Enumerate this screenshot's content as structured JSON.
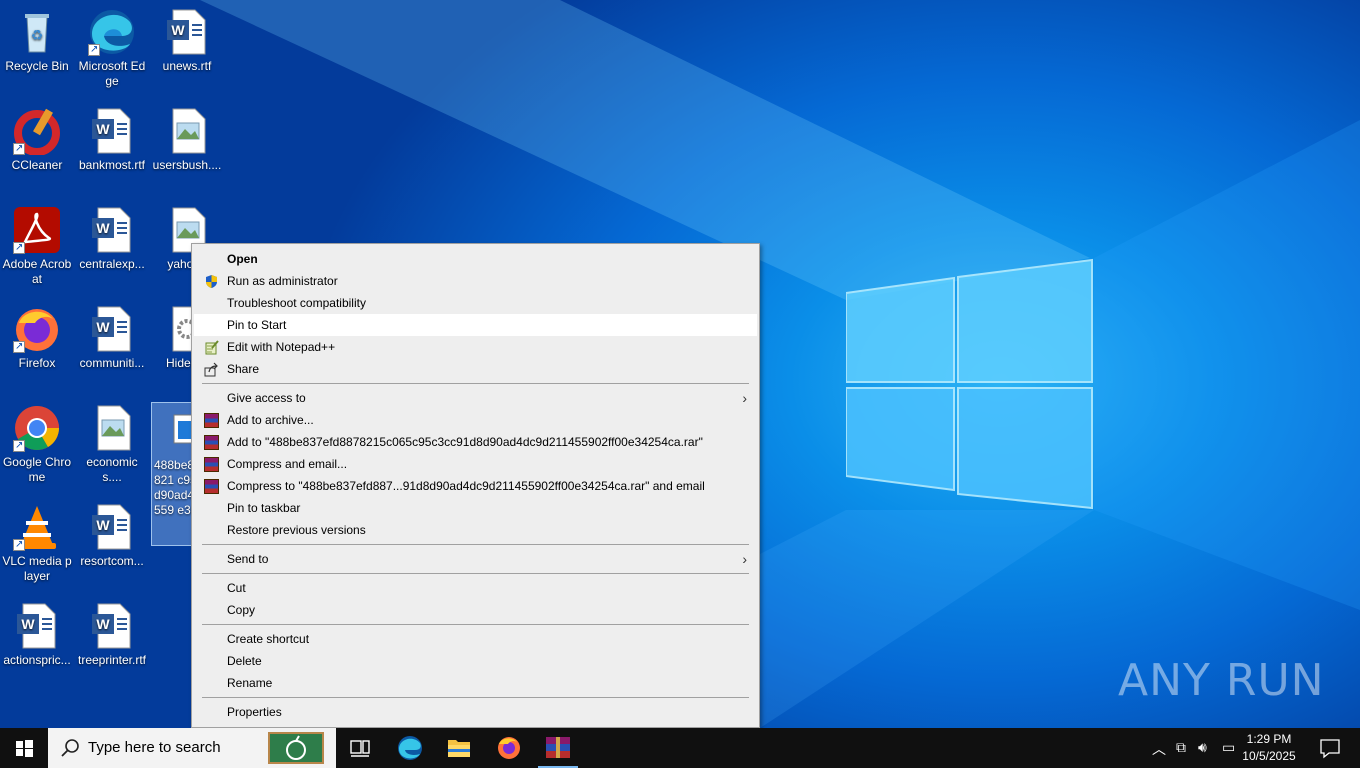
{
  "desktop_icons": [
    {
      "label": "Recycle Bin",
      "icon": "recycle-bin-icon"
    },
    {
      "label": "Microsoft Edge",
      "icon": "edge-icon"
    },
    {
      "label": "unews.rtf",
      "icon": "word-doc-icon"
    },
    {
      "label": "CCleaner",
      "icon": "ccleaner-icon"
    },
    {
      "label": "bankmost.rtf",
      "icon": "word-doc-icon"
    },
    {
      "label": "usersbush....",
      "icon": "image-file-icon"
    },
    {
      "label": "Adobe Acrobat",
      "icon": "acrobat-icon"
    },
    {
      "label": "centralexp...",
      "icon": "word-doc-icon"
    },
    {
      "label": "yahoog",
      "icon": "image-file-icon"
    },
    {
      "label": "Firefox",
      "icon": "firefox-icon"
    },
    {
      "label": "communiti...",
      "icon": "word-doc-icon"
    },
    {
      "label": "HidePlu",
      "icon": "settings-file-icon"
    },
    {
      "label": "Google Chrome",
      "icon": "chrome-icon"
    },
    {
      "label": "economics....",
      "icon": "image-file-icon"
    },
    {
      "label": "488be8 887821 c95c3c d90ad4 114559 e34254",
      "icon": "exe-file-icon"
    },
    {
      "label": "VLC media player",
      "icon": "vlc-icon"
    },
    {
      "label": "resortcom...",
      "icon": "word-doc-icon"
    },
    {
      "label": "actionspric...",
      "icon": "word-doc-icon"
    },
    {
      "label": "treeprinter.rtf",
      "icon": "word-doc-icon"
    }
  ],
  "context_menu": {
    "items": [
      {
        "label": "Open",
        "bold": true
      },
      {
        "label": "Run as administrator",
        "icon": "uac-shield-icon"
      },
      {
        "label": "Troubleshoot compatibility"
      },
      {
        "label": "Pin to Start",
        "hover": true
      },
      {
        "label": "Edit with Notepad++",
        "icon": "notepadpp-icon"
      },
      {
        "label": "Share",
        "icon": "share-icon"
      },
      {
        "label": "Give access to",
        "submenu": true
      },
      {
        "label": "Add to archive...",
        "icon": "winrar-icon"
      },
      {
        "label": "Add to \"488be837efd8878215c065c95c3cc91d8d90ad4dc9d211455902ff00e34254ca.rar\"",
        "icon": "winrar-icon"
      },
      {
        "label": "Compress and email...",
        "icon": "winrar-icon"
      },
      {
        "label": "Compress to \"488be837efd887...91d8d90ad4dc9d211455902ff00e34254ca.rar\" and email",
        "icon": "winrar-icon"
      },
      {
        "label": "Pin to taskbar"
      },
      {
        "label": "Restore previous versions"
      },
      {
        "label": "Send to",
        "submenu": true
      },
      {
        "label": "Cut"
      },
      {
        "label": "Copy"
      },
      {
        "label": "Create shortcut"
      },
      {
        "label": "Delete"
      },
      {
        "label": "Rename"
      },
      {
        "label": "Properties"
      }
    ]
  },
  "taskbar": {
    "search_placeholder": "Type here to search",
    "pinned": [
      "task-view-icon",
      "edge-icon",
      "file-explorer-icon",
      "firefox-icon",
      "winrar-icon"
    ],
    "clock_time": "1:29 PM",
    "clock_date": "10/5/2025"
  },
  "watermark": "ANY RUN",
  "colors": {
    "menu_bg": "#eeeeee",
    "menu_hover": "#ffffff",
    "taskbar_bg": "#101010",
    "accent": "#0078d7"
  }
}
